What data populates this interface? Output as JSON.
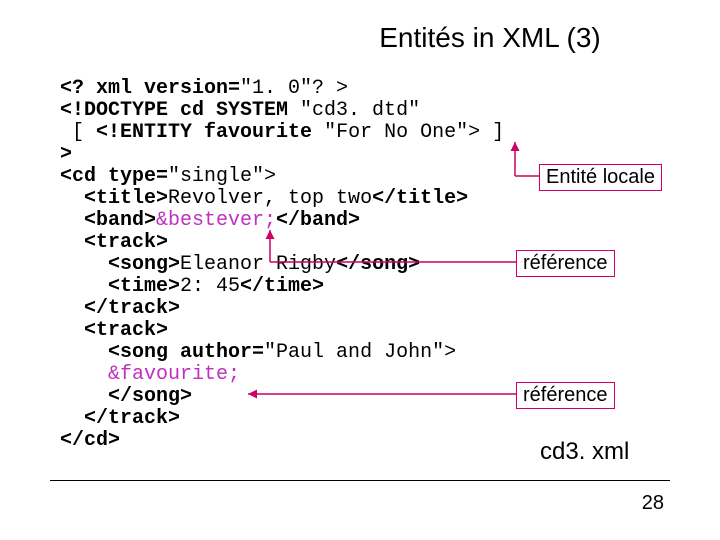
{
  "title": "Entités in XML (3)",
  "code": {
    "l01a": "<? xml ",
    "l01b": "version=",
    "l01c": "\"1. 0\"? >",
    "l02a": "<!DOCTYPE cd SYSTEM ",
    "l02b": "\"cd3. dtd\"",
    "l03a": " [ ",
    "l03b": "<!ENTITY favourite ",
    "l03c": "\"For No One\"> ]",
    "l04": ">",
    "l05a": "<cd ",
    "l05b": "type=",
    "l05c": "\"single\">",
    "l06a": "  <title>",
    "l06b": "Revolver, top two",
    "l06c": "</title>",
    "l07a": "  <band>",
    "l07b": "&bestever;",
    "l07c": "</band>",
    "l08": "  <track>",
    "l09a": "    <song>",
    "l09b": "Eleanor Rigby",
    "l09c": "</song>",
    "l10a": "    <time>",
    "l10b": "2: 45",
    "l10c": "</time>",
    "l11": "  </track>",
    "l12": "  <track>",
    "l13a": "    <song ",
    "l13b": "author=",
    "l13c": "\"Paul and John\">",
    "l14": "    ",
    "l14b": "&favourite;",
    "l15": "    </song>",
    "l16": "  </track>",
    "l17": "</cd>"
  },
  "labels": {
    "local": "Entité locale",
    "ref1": "référence",
    "ref2": "référence"
  },
  "caption": "cd3. xml",
  "page": "28"
}
